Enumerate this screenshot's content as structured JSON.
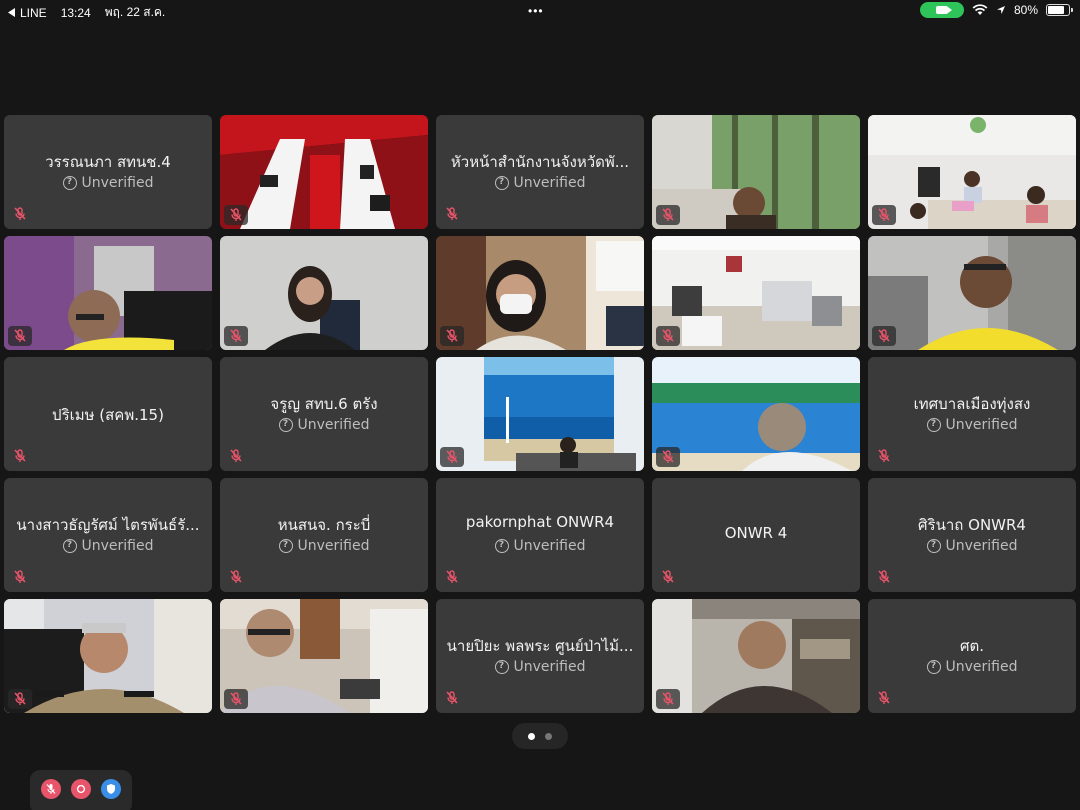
{
  "status_bar": {
    "back_app": "LINE",
    "time": "13:24",
    "date": "พฤ. 22 ส.ค.",
    "more": "•••",
    "battery": "80%",
    "battery_level": 0.8
  },
  "verified_label": "Unverified",
  "tiles": [
    {
      "kind": "name",
      "name": "วรรณนภา สทนช.4",
      "unverified": true
    },
    {
      "kind": "video",
      "scene": "red-conference-room"
    },
    {
      "kind": "name",
      "name": "หัวหน้าสำนักงานจังหวัดพั...",
      "unverified": true
    },
    {
      "kind": "video",
      "scene": "man-forest-backdrop"
    },
    {
      "kind": "video",
      "scene": "office-group"
    },
    {
      "kind": "video",
      "scene": "man-glasses-yellow"
    },
    {
      "kind": "video",
      "scene": "woman-phone"
    },
    {
      "kind": "video",
      "scene": "woman-mask"
    },
    {
      "kind": "video",
      "scene": "empty-office"
    },
    {
      "kind": "video",
      "scene": "man-yellow-shirt"
    },
    {
      "kind": "name",
      "name": "ปริเมษ (สคพ.15)",
      "unverified": false
    },
    {
      "kind": "name",
      "name": "จรูญ สทบ.6 ตรัง",
      "unverified": true
    },
    {
      "kind": "video",
      "scene": "songkhla-backdrop"
    },
    {
      "kind": "video",
      "scene": "river-backdrop"
    },
    {
      "kind": "name",
      "name": "เทศบาลเมืองทุ่งสง",
      "unverified": true
    },
    {
      "kind": "name",
      "name": "นางสาวธัญรัศม์ ไตรพันธ์รั...",
      "unverified": true
    },
    {
      "kind": "name",
      "name": "หนสนจ. กระบี่",
      "unverified": true
    },
    {
      "kind": "name",
      "name": "pakornphat ONWR4",
      "unverified": true
    },
    {
      "kind": "name",
      "name": "ONWR 4",
      "unverified": false
    },
    {
      "kind": "name",
      "name": "ศิรินาถ ONWR4",
      "unverified": true
    },
    {
      "kind": "video",
      "scene": "officer-uniform"
    },
    {
      "kind": "video",
      "scene": "man-glasses-office"
    },
    {
      "kind": "name",
      "name": "นายปิยะ พลพระ ศูนย์ป่าไม้...",
      "unverified": true
    },
    {
      "kind": "video",
      "scene": "man-bookshelf"
    },
    {
      "kind": "name",
      "name": "ศต.",
      "unverified": true
    }
  ],
  "pager": {
    "pages": 2,
    "current": 1
  },
  "controls": [
    {
      "icon": "mic-off-icon",
      "color": "#e8546a"
    },
    {
      "icon": "camera-icon",
      "color": "#e8546a"
    },
    {
      "icon": "shield-icon",
      "color": "#3a8ee8"
    }
  ]
}
